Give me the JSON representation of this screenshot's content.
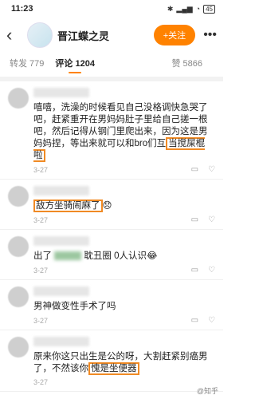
{
  "status": {
    "time": "11:23",
    "battery": "45"
  },
  "header": {
    "title": "晋江蝶之灵",
    "follow_label": "+关注"
  },
  "tabs": [
    {
      "label": "转发 779"
    },
    {
      "label": "评论 1204"
    },
    {
      "label": "赞 5866"
    }
  ],
  "comments": [
    {
      "text": "嘻嘻，洗澡的时候看见自己没格调快急哭了吧，赶紧重开在男妈妈肚子里给自己搓一根吧，然后记得从钢门里爬出来，因为这是男妈妈捏，等出来就可以和bro们互",
      "highlight": "当搅屎棍啦",
      "time": "3-27"
    },
    {
      "text": "",
      "highlight": "敌方坐骑闹麻了",
      "emoji": "😞",
      "time": "3-27"
    },
    {
      "text": "出了",
      "middle": "耽丑圈 0人认识",
      "emoji": "😂",
      "time": "3-27"
    },
    {
      "text": "男神做变性手术了吗",
      "time": "3-27"
    },
    {
      "text": "原来你这只出生是公的呀，大割赶紧别癌男了，不然该你",
      "highlight": "愧是坐便器",
      "time": "3-27"
    }
  ],
  "watermark": "@知乎"
}
